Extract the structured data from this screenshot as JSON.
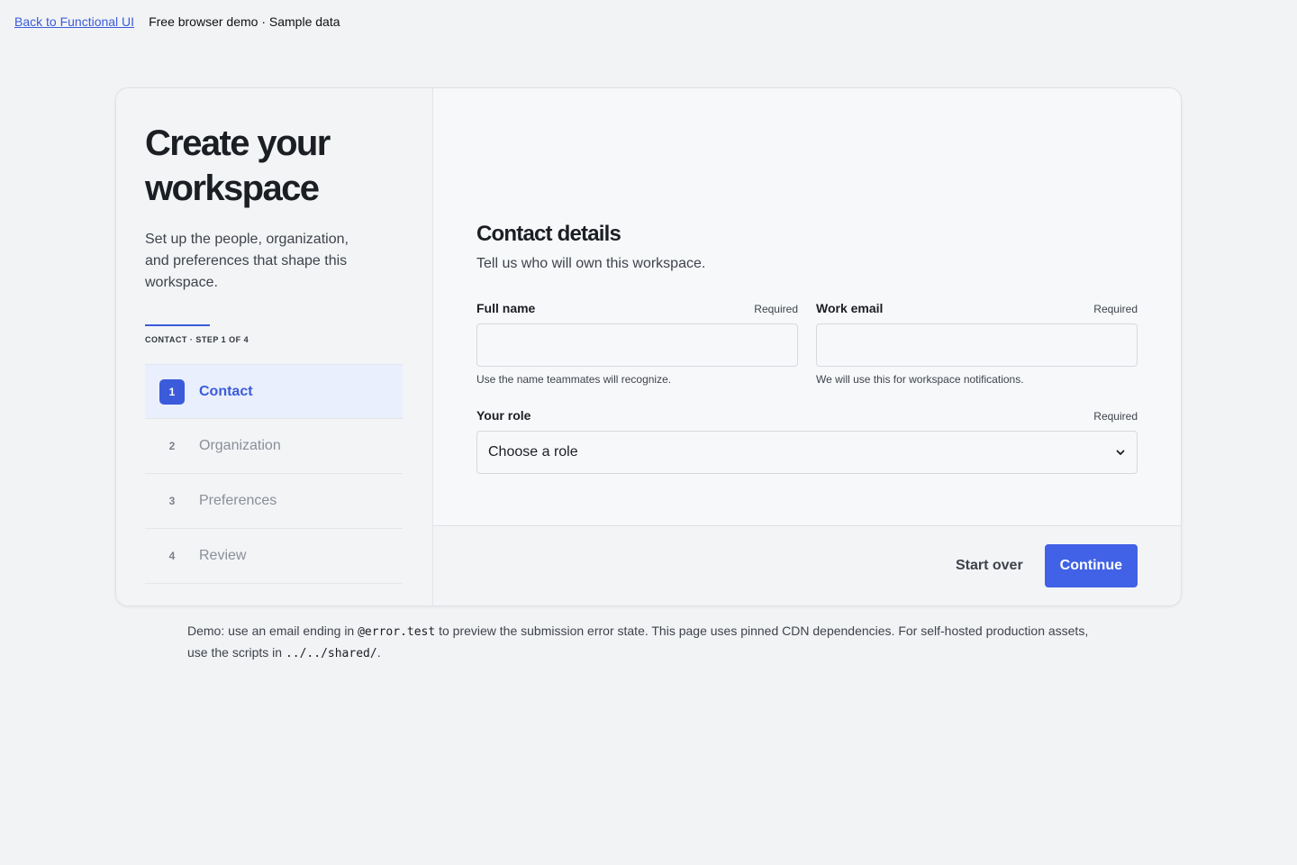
{
  "topbar": {
    "back_link": "Back to Functional UI",
    "demo_label": "Free browser demo · Sample data"
  },
  "sidebar": {
    "title": "Create your workspace",
    "subtitle": "Set up the people, organization, and preferences that shape this workspace.",
    "step_caption": "CONTACT · STEP 1 OF 4",
    "progress": 0.25,
    "steps": [
      {
        "num": "1",
        "label": "Contact",
        "active": true
      },
      {
        "num": "2",
        "label": "Organization",
        "active": false
      },
      {
        "num": "3",
        "label": "Preferences",
        "active": false
      },
      {
        "num": "4",
        "label": "Review",
        "active": false
      }
    ]
  },
  "form": {
    "title": "Contact details",
    "subtitle": "Tell us who will own this workspace.",
    "full_name": {
      "label": "Full name",
      "required": "Required",
      "value": "",
      "hint": "Use the name teammates will recognize."
    },
    "work_email": {
      "label": "Work email",
      "required": "Required",
      "value": "",
      "hint": "We will use this for workspace notifications."
    },
    "role": {
      "label": "Your role",
      "required": "Required",
      "selected": "Choose a role"
    }
  },
  "footer": {
    "start_over": "Start over",
    "continue": "Continue"
  },
  "note": {
    "part1": "Demo: use an email ending in ",
    "code1": "@error.test",
    "part2": " to preview the submission error state. This page uses pinned CDN dependencies. For self-hosted production assets, use the scripts in ",
    "code2": "../../shared/",
    "part3": "."
  },
  "colors": {
    "accent": "#3b5bdb",
    "primary_button": "#4162e6",
    "background": "#f2f3f5"
  }
}
